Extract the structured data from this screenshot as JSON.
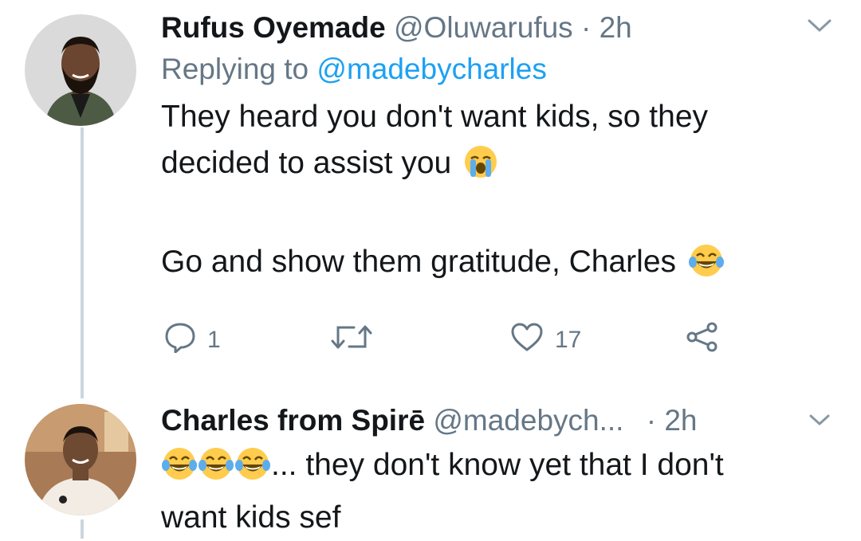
{
  "tweet1": {
    "name": "Rufus Oyemade",
    "handle": "@Oluwarufus",
    "separator": "·",
    "time": "2h",
    "replying_prefix": "Replying to",
    "replying_mention": "@madebycharles",
    "text_line1": "They heard you don't want kids, so they",
    "text_line2": "decided to assist you",
    "emoji1": "loudly-crying-face",
    "text_line3": "Go and show them gratitude, Charles",
    "emoji2": "face-with-tears-of-joy",
    "actions": {
      "reply_count": "1",
      "retweet_count": "",
      "like_count": "17"
    },
    "caret_icon": "chevron-down-icon"
  },
  "tweet2": {
    "name": "Charles from Spirē",
    "handle": "@madebych...",
    "separator": "·",
    "time": "2h",
    "text_after_emojis": "... they don't know yet that I don't",
    "text_line2": "want kids sef",
    "emojis": [
      "face-with-tears-of-joy",
      "face-with-tears-of-joy",
      "face-with-tears-of-joy"
    ],
    "caret_icon": "chevron-down-icon"
  },
  "colors": {
    "text": "#14171a",
    "secondary": "#657786",
    "link": "#1da1f2",
    "thread_line": "#ccd6dd"
  }
}
